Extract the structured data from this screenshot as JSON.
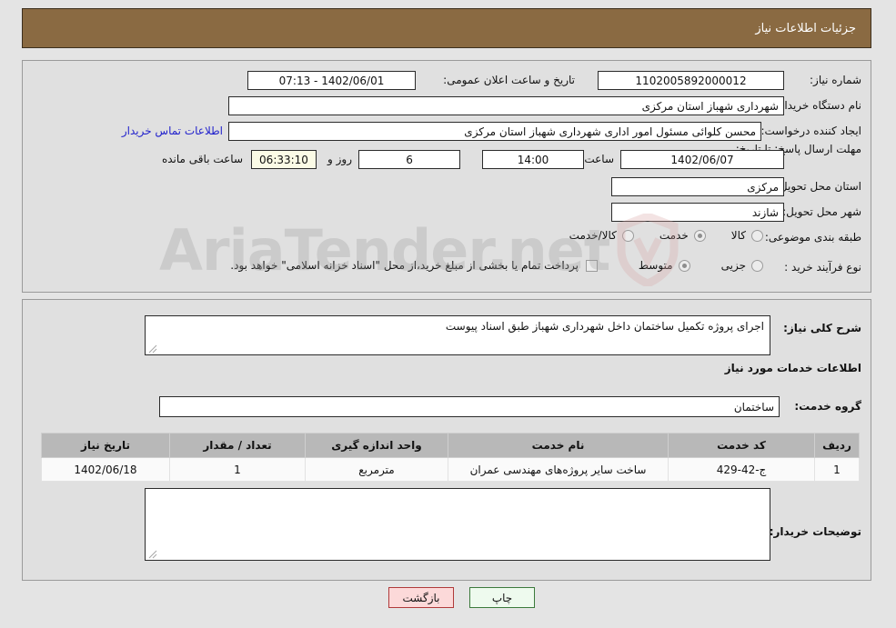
{
  "header": {
    "title": "جزئیات اطلاعات نیاز"
  },
  "form": {
    "need_number_label": "شماره نیاز:",
    "need_number_value": "1102005892000012",
    "public_announce_label": "تاریخ و ساعت اعلان عمومی:",
    "public_announce_value": "1402/06/01 - 07:13",
    "buyer_org_label": "نام دستگاه خریدار:",
    "buyer_org_value": "شهرداری شهباز استان مرکزی",
    "creator_label": "ایجاد کننده درخواست:",
    "creator_value": "محسن کلوائی مسئول امور اداری شهرداری شهباز استان مرکزی",
    "buyer_contact_link": "اطلاعات تماس خریدار",
    "deadline_label": "مهلت ارسال پاسخ: تا تاریخ:",
    "deadline_date": "1402/06/07",
    "deadline_hour_label": "ساعت",
    "deadline_hour_value": "14:00",
    "days_value": "6",
    "days_label": "روز و",
    "countdown_value": "06:33:10",
    "countdown_label": "ساعت باقی مانده",
    "province_label": "استان محل تحویل:",
    "province_value": "مرکزی",
    "city_label": "شهر محل تحویل:",
    "city_value": "شازند",
    "category_label": "طبقه بندی موضوعی:",
    "category_options": [
      {
        "label": "کالا",
        "selected": false
      },
      {
        "label": "خدمت",
        "selected": true
      },
      {
        "label": "کالا/خدمت",
        "selected": false
      }
    ],
    "process_label": "نوع فرآیند خرید :",
    "process_options": [
      {
        "label": "جزیی",
        "selected": false
      },
      {
        "label": "متوسط",
        "selected": true
      }
    ],
    "treasury_checkbox_checked": false,
    "treasury_text": "پرداخت تمام یا بخشی از مبلغ خرید،از محل \"اسناد خزانه اسلامی\" خواهد بود."
  },
  "detail": {
    "need_desc_label": "شرح کلی نیاز:",
    "need_desc_value": "اجرای پروژه تکمیل ساختمان داخل شهرداری شهباز طبق اسناد پیوست",
    "services_section_title": "اطلاعات خدمات مورد نیاز",
    "service_group_label": "گروه خدمت:",
    "service_group_value": "ساختمان",
    "buyer_notes_label": "توضیحات خریدار:",
    "buyer_notes_value": ""
  },
  "table": {
    "columns": [
      "ردیف",
      "کد خدمت",
      "نام خدمت",
      "واحد اندازه گیری",
      "تعداد / مقدار",
      "تاریخ نیاز"
    ],
    "rows": [
      {
        "row": "1",
        "code": "ج-42-429",
        "name": "ساخت سایر پروژه‌های مهندسی عمران",
        "unit": "مترمربع",
        "qty": "1",
        "date": "1402/06/18"
      }
    ]
  },
  "buttons": {
    "print": "چاپ",
    "back": "بازگشت"
  },
  "watermark": {
    "text": "AriaTender.net"
  },
  "colors": {
    "header_bg": "#8a6a42",
    "page_bg": "#e4e4e4",
    "panel_bg": "#e0e0e0",
    "link": "#2222cc",
    "table_header_bg": "#b8b8b8",
    "print_bg": "#eefaee",
    "back_bg": "#fcd9d9"
  }
}
